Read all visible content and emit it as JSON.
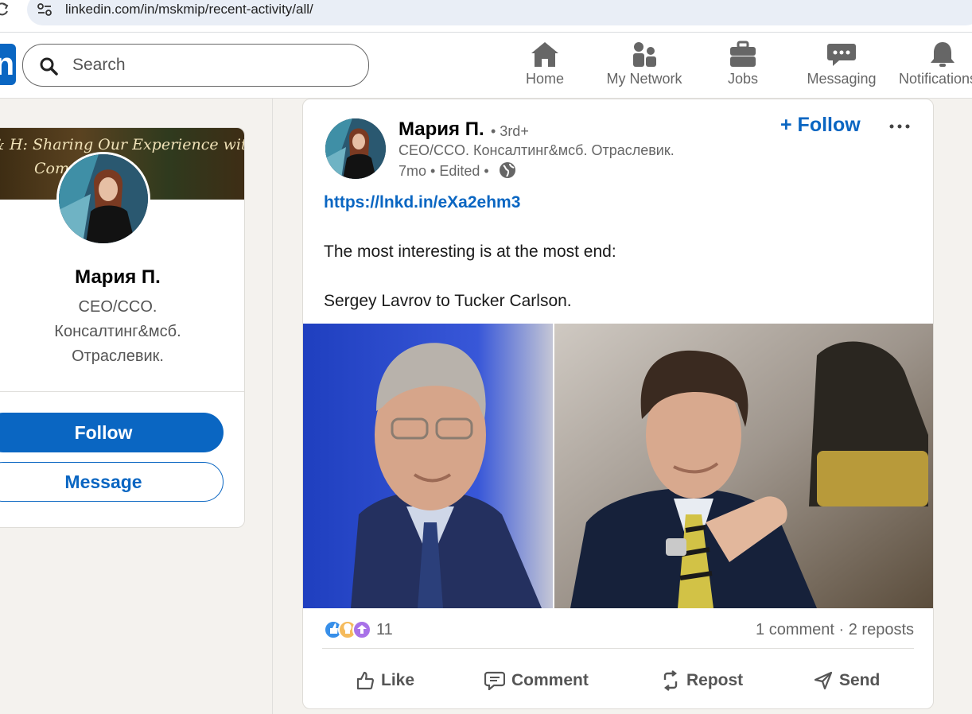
{
  "browser": {
    "url": "linkedin.com/in/mskmip/recent-activity/all/"
  },
  "nav": {
    "search_placeholder": "Search",
    "items": [
      {
        "label": "Home",
        "icon": "home-icon"
      },
      {
        "label": "My Network",
        "icon": "network-icon"
      },
      {
        "label": "Jobs",
        "icon": "briefcase-icon"
      },
      {
        "label": "Messaging",
        "icon": "messaging-icon"
      },
      {
        "label": "Notifications",
        "icon": "bell-icon"
      }
    ]
  },
  "profile": {
    "banner_line1": "& H: Sharing Our Experience with",
    "banner_line2": "Com              People",
    "name": "Мария П.",
    "headline": "CEO/CCO. Консалтинг&мсб. Отраслевик.",
    "follow_label": "Follow",
    "message_label": "Message"
  },
  "post": {
    "author_name": "Мария П.",
    "degree": "• 3rd+",
    "author_headline": "CEO/CCO. Консалтинг&мсб. Отраслевик.",
    "meta": "7mo • Edited •",
    "follow_label": "+ Follow",
    "link": "https://lnkd.in/eXa2ehm3",
    "text_line1": "The most interesting is at the most end:",
    "text_line2": "Sergey Lavrov to Tucker Carlson.",
    "reactions_count": "11",
    "social_counts": "1 comment · 2 reposts",
    "actions": {
      "like": "Like",
      "comment": "Comment",
      "repost": "Repost",
      "send": "Send"
    }
  },
  "colors": {
    "brand": "#0a66c2",
    "page_bg": "#f4f2ee"
  }
}
